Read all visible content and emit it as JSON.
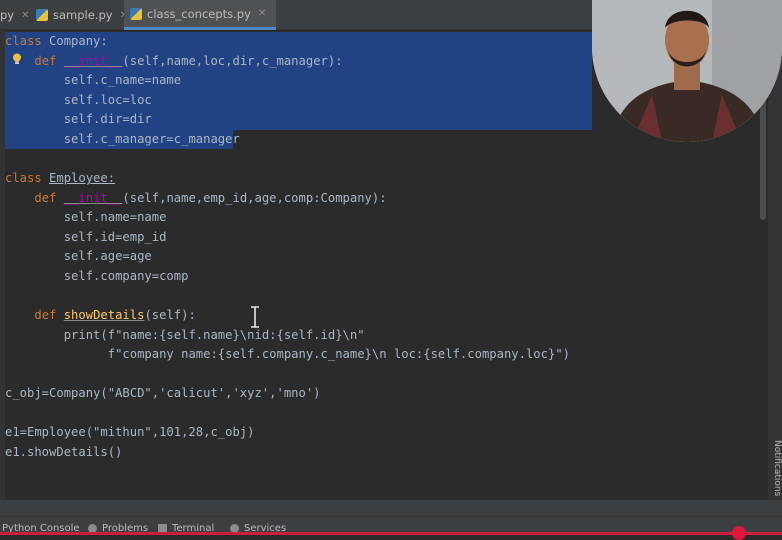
{
  "tabs": [
    {
      "label": "py"
    },
    {
      "label": "sample.py"
    },
    {
      "label": "class_concepts.py",
      "active": true
    }
  ],
  "code": {
    "company_class": "class",
    "company_name": "Company:",
    "def": "def",
    "init": "__init__",
    "company_params": "(self,name,loc,dir,c_manager):",
    "l3": "self.c_name=name",
    "l4": "self.loc=loc",
    "l5": "self.dir=dir",
    "l6": "self.c_manager=c_manager",
    "employee_class": "class",
    "employee_name": "Employee:",
    "employee_params": "(self,name,emp_id,age,comp:Company):",
    "e3": "self.name=name",
    "e4": "self.id=emp_id",
    "e5": "self.age=age",
    "e6": "self.company=comp",
    "show_def": "def",
    "show_name": "showDetails",
    "show_params": "(self):",
    "print_line": "print(f\"name:{self.name}\\nid:{self.id}\\n\"",
    "print_cont": "f\"company name:{self.company.c_name}\\n loc:{self.company.loc}\")",
    "cobj": "c_obj=Company(\"ABCD\",'calicut','xyz','mno')",
    "e1": "e1=Employee(\"mithun\",101,28,c_obj)",
    "call": "e1.showDetails()"
  },
  "bottom_tools": [
    {
      "label": "Python Console"
    },
    {
      "label": "Problems"
    },
    {
      "label": "Terminal"
    },
    {
      "label": "Services"
    }
  ],
  "notifications_label": "Notifications",
  "colors": {
    "editor_bg": "#2b2b2b",
    "selection": "#214283",
    "keyword": "#cc7832",
    "self": "#94558d",
    "function": "#ffc66d",
    "string": "#6a8759",
    "number": "#6897bb"
  }
}
